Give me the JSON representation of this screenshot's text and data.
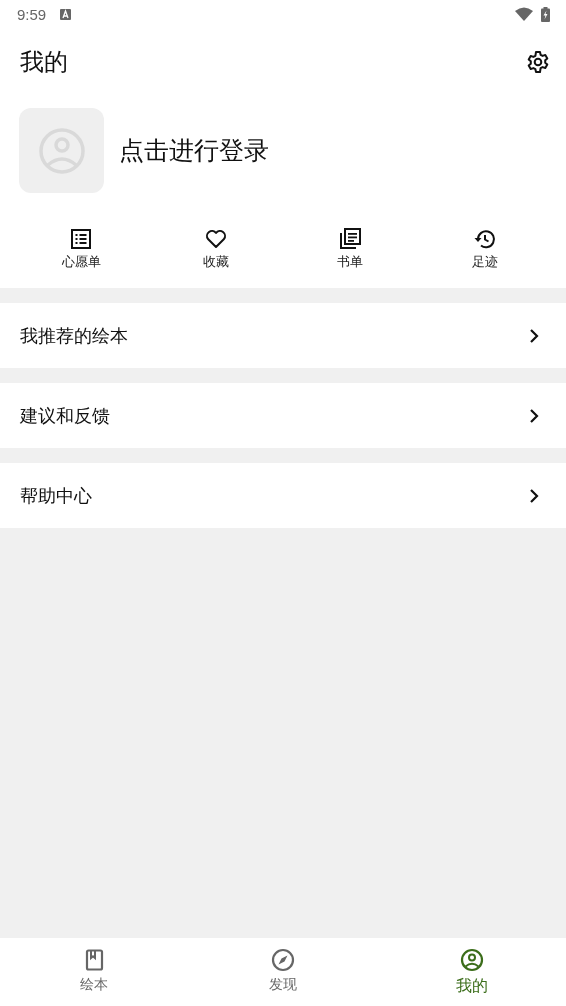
{
  "status_bar": {
    "time": "9:59"
  },
  "header": {
    "title": "我的"
  },
  "profile": {
    "login_prompt": "点击进行登录"
  },
  "shortcuts": [
    {
      "label": "心愿单"
    },
    {
      "label": "收藏"
    },
    {
      "label": "书单"
    },
    {
      "label": "足迹"
    }
  ],
  "menu": [
    {
      "label": "我推荐的绘本"
    },
    {
      "label": "建议和反馈"
    },
    {
      "label": "帮助中心"
    }
  ],
  "bottom_nav": [
    {
      "label": "绘本",
      "selected": false
    },
    {
      "label": "发现",
      "selected": false
    },
    {
      "label": "我的",
      "selected": true
    }
  ]
}
